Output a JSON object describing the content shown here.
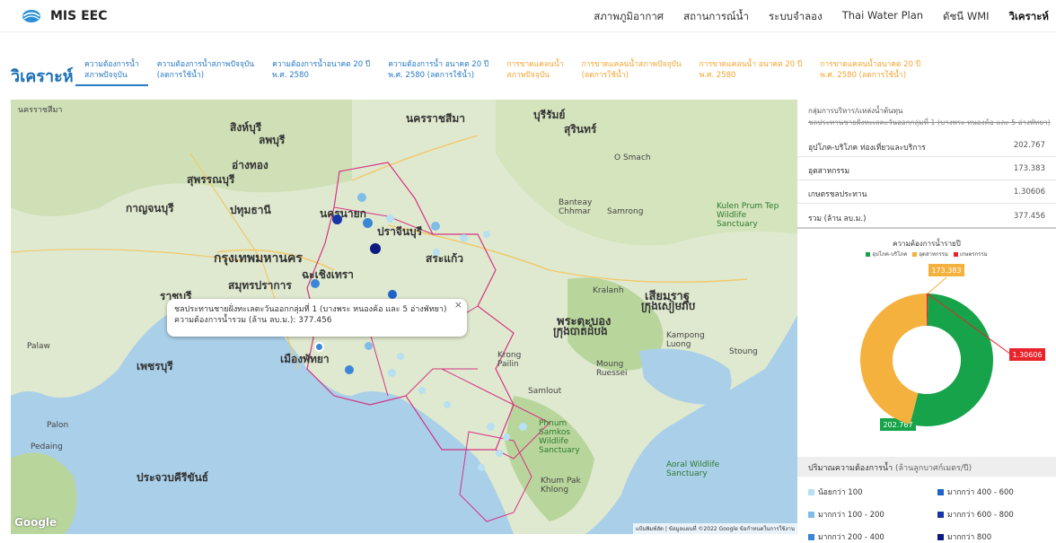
{
  "header": {
    "brand": "MIS EEC",
    "nav": [
      {
        "label": "สภาพภูมิอากาศ",
        "active": false
      },
      {
        "label": "สถานการณ์น้ำ",
        "active": false
      },
      {
        "label": "ระบบจำลอง",
        "active": false
      },
      {
        "label": "Thai Water Plan",
        "active": false
      },
      {
        "label": "ดัชนี WMI",
        "active": false
      },
      {
        "label": "วิเคราะห์",
        "active": true
      }
    ]
  },
  "page_title": "วิเคราะห์",
  "tabs": [
    {
      "line1": "ความต้องการน้ำ",
      "line2": "สภาพปัจจุบัน",
      "color": "blue",
      "active": true
    },
    {
      "line1": "ความต้องการน้ำสภาพปัจจุบัน",
      "line2": "(ลดการใช้น้ำ)",
      "color": "blue",
      "active": false
    },
    {
      "line1": "ความต้องการน้ำอนาคต 20 ปี",
      "line2": "พ.ศ. 2580",
      "color": "blue",
      "active": false
    },
    {
      "line1": "ความต้องการน้ำ อนาคต 20 ปี",
      "line2": "พ.ศ. 2580 (ลดการใช้น้ำ)",
      "color": "blue",
      "active": false
    },
    {
      "line1": "การขาดแคลนน้ำ",
      "line2": "สภาพปัจจุบัน",
      "color": "orange",
      "active": false
    },
    {
      "line1": "การขาดแคลนน้ำสภาพปัจจุบัน",
      "line2": "(ลดการใช้น้ำ)",
      "color": "orange",
      "active": false
    },
    {
      "line1": "การขาดแคลนน้ำ อนาคต 20 ปี",
      "line2": "พ.ศ. 2580",
      "color": "orange",
      "active": false
    },
    {
      "line1": "การขาดแคลนน้ำอนาคต 20 ปี",
      "line2": "พ.ศ. 2580 (ลดการใช้น้ำ)",
      "color": "orange",
      "active": false
    }
  ],
  "map": {
    "labels": {
      "nakhon_ratchasima": "นครราชสีมา",
      "buriram": "บุรีรัมย์",
      "surin": "สุรินทร์",
      "singburi": "สิงห์บุรี",
      "lopburi": "ลพบุรี",
      "angthong": "อ่างทอง",
      "suphanburi": "สุพรรณบุรี",
      "kanchanaburi": "กาญจนบุรี",
      "pathumthani": "ปทุมธานี",
      "bangkok": "กรุงเทพมหานคร",
      "chachoengsao": "ฉะเชิงเทรา",
      "samutprakan": "สมุทรปราการ",
      "ratchaburi": "ราชบุรี",
      "phetchaburi": "เพชรบุรี",
      "pattaya": "เมืองพัทยา",
      "prachinburi": "ปราจีนบุรี",
      "nakhon_nayok": "นครนายก",
      "sa_kaeo": "สระแก้ว",
      "siem_reap": "เสียมราฐ",
      "siem_reap_km": "ក្រុងសៀមរាប",
      "battambang": "พระตะบอง",
      "battambang_km": "ក្រុងបាត់ដំបង",
      "prachuap": "ประจวบคีรีขันธ์",
      "palaw": "Palaw",
      "palon": "Palon",
      "pedaing": "Pedaing",
      "o_smach": "O Smach",
      "banteay": "Banteay Chhmar",
      "samrong": "Samrong",
      "kulen": "Kulen Prum Tep Wildlife Sanctuary",
      "kampong": "Kampong Luong",
      "stoung": "Stoung",
      "phnum_samkos": "Phnum Samkos Wildlife Sanctuary",
      "aoral": "Aoral Wildlife Sanctuary",
      "khum_pak": "Khum Pak Khlong",
      "krong_pailin": "Krong Pailin",
      "moung": "Moung Ruessei",
      "kralanh": "Kralanh",
      "samlout": "Samlout"
    },
    "popup_line1": "ชลประทานชายฝั่งทะเลตะวันออกกลุ่มที่ 1 (บางพระ หนองค้อ และ 5 อ่างพัทยา)",
    "popup_line2": "ความต้องการน้ำรวม (ล้าน ลบ.ม.): 377.456",
    "popup_close": "×",
    "google": "Google",
    "attribution": "แป้นพิมพ์ลัด | ข้อมูลแผนที่ ©2022 Google  ข้อกำหนดในการใช้งาน"
  },
  "side": {
    "header1": "กลุ่มการบริหาร/แหล่งน้ำต้นทุน",
    "header2": "ชลประทานชายฝั่งทะเลตะวันออกกลุ่มที่ 1 (บางพระ หนองค้อ และ 5 อ่างพัทยา)",
    "rows": [
      {
        "label": "อุปโภค-บริโภค ท่องเที่ยวและบริการ",
        "value": "202.767"
      },
      {
        "label": "อุตสาหกรรม",
        "value": "173.383"
      },
      {
        "label": "เกษตรชลประทาน",
        "value": "1.30606"
      },
      {
        "label": "รวม (ล้าน ลบ.ม.)",
        "value": "377.456"
      }
    ],
    "legend_title": "ปริมาณความต้องการน้ำ",
    "legend_unit": "(ล้านลูกบาศก์เมตร/ปี)",
    "legend_items": [
      {
        "label": "น้อยกว่า 100",
        "color": "#b7e0f2"
      },
      {
        "label": "มากกว่า 400 - 600",
        "color": "#1f63c8"
      },
      {
        "label": "มากกว่า 100 - 200",
        "color": "#7fbde6"
      },
      {
        "label": "มากกว่า 600 - 800",
        "color": "#1636a8"
      },
      {
        "label": "มากกว่า 200 - 400",
        "color": "#3b86d6"
      },
      {
        "label": "มากกว่า 800",
        "color": "#0a1a80"
      }
    ]
  },
  "chart_data": {
    "type": "pie",
    "title": "ความต้องการน้ำรายปี",
    "categories": [
      "อุปโภค-บริโภค",
      "อุตสาหกรรม",
      "เกษตรกรรม"
    ],
    "values": [
      202.767,
      173.383,
      1.30606
    ],
    "value_labels": [
      "202.767",
      "173.383",
      "1.30606"
    ],
    "colors": [
      "#17a34a",
      "#f5b13d",
      "#e8232a"
    ],
    "donut": true,
    "legend_position": "top"
  }
}
